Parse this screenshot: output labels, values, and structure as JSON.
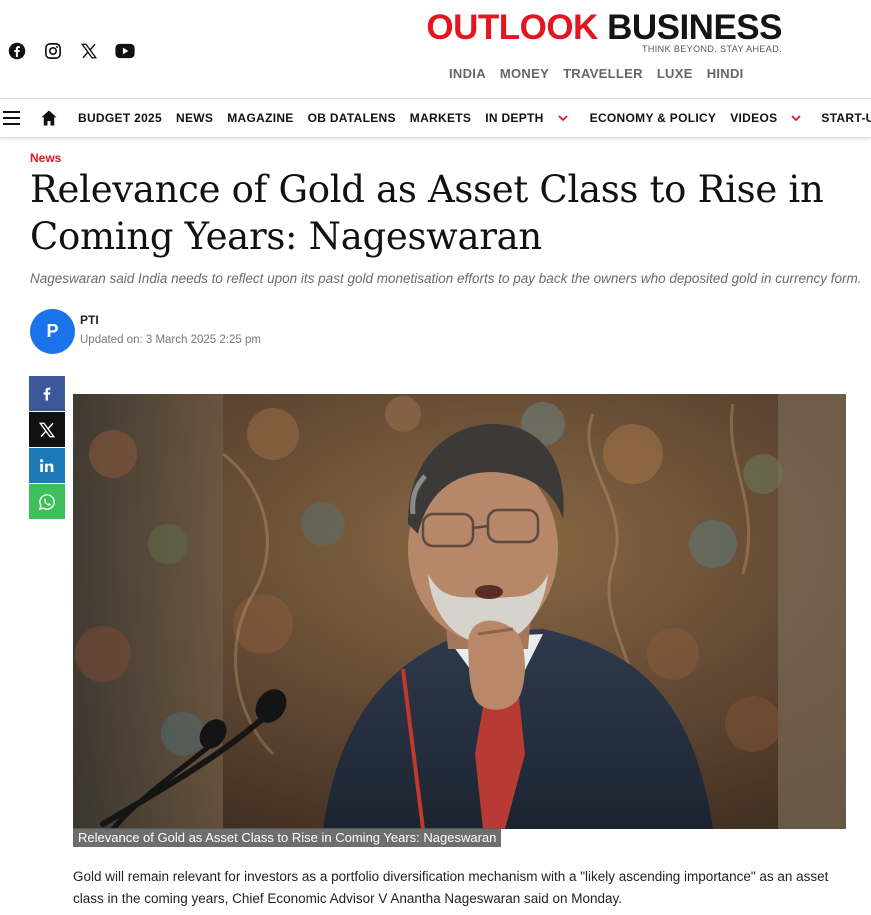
{
  "header": {
    "social_icons": [
      "facebook-icon",
      "instagram-icon",
      "x-icon",
      "youtube-icon"
    ],
    "logo_word1": "OUTLOOK",
    "logo_word2": "BUSINESS",
    "tagline": "THINK BEYOND. STAY AHEAD.",
    "editions": [
      "INDIA",
      "MONEY",
      "TRAVELLER",
      "LUXE",
      "HINDI"
    ]
  },
  "nav": {
    "items": [
      {
        "label": "BUDGET 2025",
        "dropdown": false
      },
      {
        "label": "NEWS",
        "dropdown": false
      },
      {
        "label": "MAGAZINE",
        "dropdown": false
      },
      {
        "label": "OB DATALENS",
        "dropdown": false
      },
      {
        "label": "MARKETS",
        "dropdown": false
      },
      {
        "label": "IN DEPTH",
        "dropdown": true
      },
      {
        "label": "ECONOMY & POLICY",
        "dropdown": false
      },
      {
        "label": "VIDEOS",
        "dropdown": true
      },
      {
        "label": "START-UP",
        "dropdown": true
      }
    ]
  },
  "article": {
    "category": "News",
    "headline": "Relevance of Gold as Asset Class to Rise in Coming Years: Nageswaran",
    "standfirst": "Nageswaran said India needs to reflect upon its past gold monetisation efforts to pay back the owners who deposited gold in currency form.",
    "author_initial": "P",
    "author": "PTI",
    "updated": "Updated on: 3 March 2025 2:25 pm",
    "image_caption": "Relevance of Gold as Asset Class to Rise in Coming Years: Nageswaran",
    "body_paragraph": "Gold will remain relevant for investors as a portfolio diversification mechanism with a \"likely ascending importance\" as an asset class in the coming years, Chief Economic Advisor V Anantha Nageswaran said on Monday."
  },
  "share": [
    "facebook-icon",
    "x-icon",
    "linkedin-icon",
    "whatsapp-icon"
  ],
  "colors": {
    "brand_red": "#e4151f",
    "avatar_blue": "#1a73e8",
    "facebook": "#3b5998",
    "linkedin": "#1d7ab8",
    "whatsapp": "#3fbf5b"
  }
}
